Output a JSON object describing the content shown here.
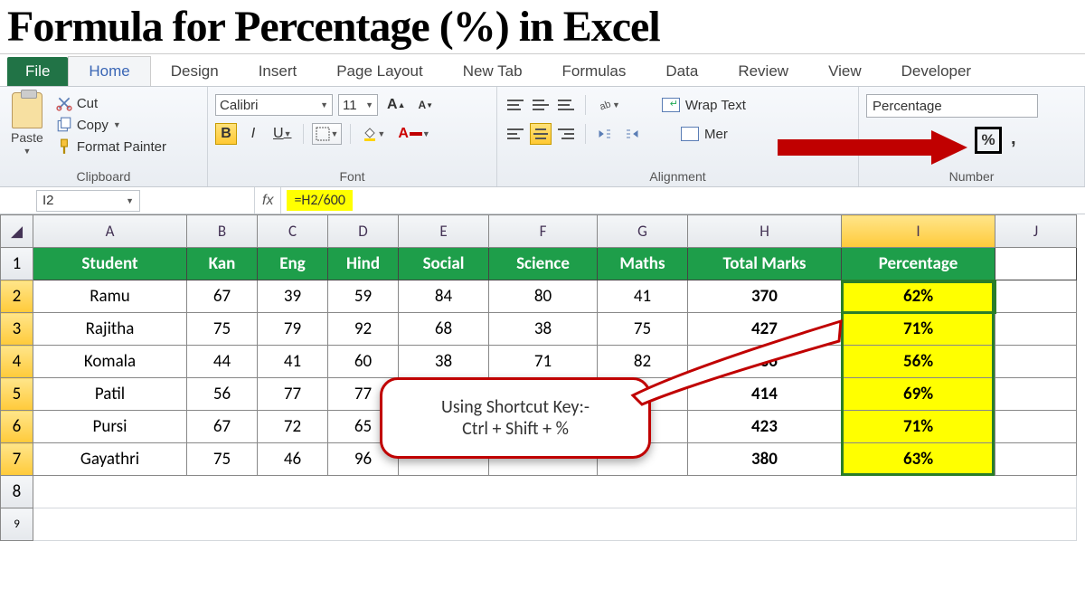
{
  "title": "Formula for Percentage (%) in Excel",
  "tabs": {
    "file": "File",
    "home": "Home",
    "design": "Design",
    "insert": "Insert",
    "pagelayout": "Page Layout",
    "newtab": "New Tab",
    "formulas": "Formulas",
    "data": "Data",
    "review": "Review",
    "view": "View",
    "developer": "Developer"
  },
  "clipboard": {
    "paste": "Paste",
    "cut": "Cut",
    "copy": "Copy",
    "painter": "Format Painter",
    "group": "Clipboard"
  },
  "font": {
    "name": "Calibri",
    "size": "11",
    "bold": "B",
    "italic": "I",
    "underline": "U",
    "group": "Font",
    "grow": "A",
    "shrink": "A"
  },
  "alignment": {
    "wrap": "Wrap Text",
    "merge": "Mer",
    "group": "Alignment"
  },
  "number": {
    "format": "Percentage",
    "percent": "%",
    "comma": ",",
    "group": "Number"
  },
  "namebox": "I2",
  "fx": "fx",
  "formula_value": "=H2/600",
  "cols": [
    "A",
    "B",
    "C",
    "D",
    "E",
    "F",
    "G",
    "H",
    "I",
    "J"
  ],
  "headers": [
    "Student",
    "Kan",
    "Eng",
    "Hind",
    "Social",
    "Science",
    "Maths",
    "Total Marks",
    "Percentage"
  ],
  "rows": [
    {
      "n": "1"
    },
    {
      "n": "2",
      "c": [
        "Ramu",
        "67",
        "39",
        "59",
        "84",
        "80",
        "41",
        "370",
        "62%"
      ]
    },
    {
      "n": "3",
      "c": [
        "Rajitha",
        "75",
        "79",
        "92",
        "68",
        "38",
        "75",
        "427",
        "71%"
      ]
    },
    {
      "n": "4",
      "c": [
        "Komala",
        "44",
        "41",
        "60",
        "38",
        "71",
        "82",
        "336",
        "56%"
      ]
    },
    {
      "n": "5",
      "c": [
        "Patil",
        "56",
        "77",
        "77",
        "",
        "",
        "",
        "414",
        "69%"
      ]
    },
    {
      "n": "6",
      "c": [
        "Pursi",
        "67",
        "72",
        "65",
        "",
        "",
        "",
        "423",
        "71%"
      ]
    },
    {
      "n": "7",
      "c": [
        "Gayathri",
        "75",
        "46",
        "96",
        "",
        "",
        "",
        "380",
        "63%"
      ]
    },
    {
      "n": "8"
    },
    {
      "n": "9"
    }
  ],
  "callout": {
    "line1": "Using Shortcut Key:-",
    "line2": "Ctrl + Shift + %"
  }
}
